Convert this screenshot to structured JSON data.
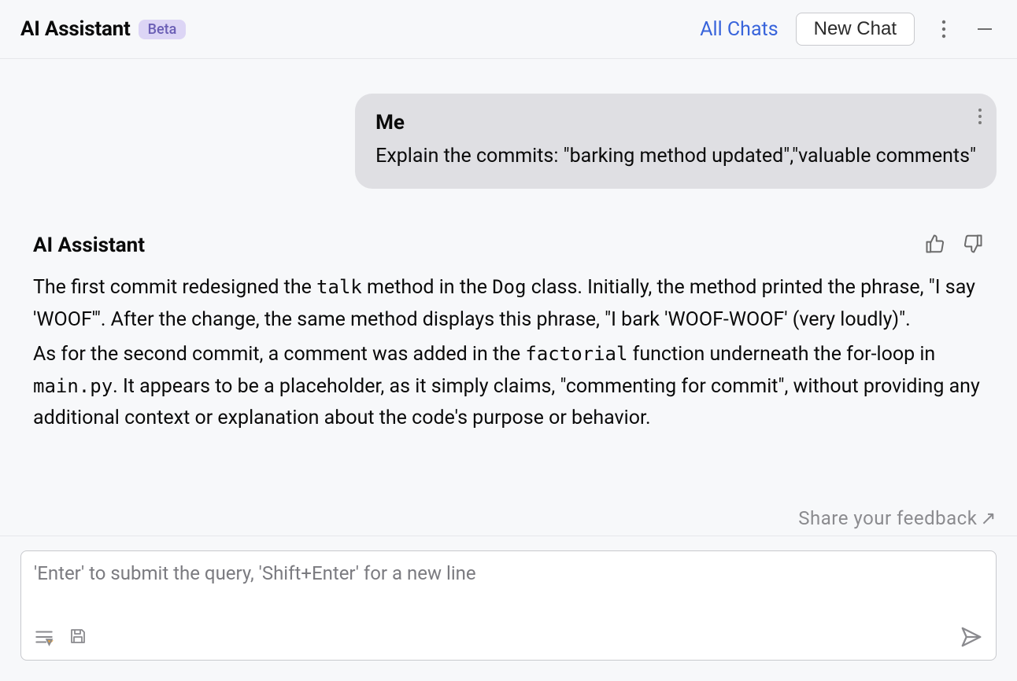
{
  "header": {
    "title": "AI Assistant",
    "badge": "Beta",
    "all_chats": "All Chats",
    "new_chat": "New Chat"
  },
  "messages": {
    "user": {
      "sender": "Me",
      "text": "Explain the commits: \"barking method updated\",\"valuable comments\""
    },
    "ai": {
      "sender": "AI Assistant",
      "p1_a": "The first commit redesigned the ",
      "p1_code1": "talk",
      "p1_b": " method in the ",
      "p1_code2": "Dog",
      "p1_c": " class. Initially, the method printed the phrase, \"I say 'WOOF'\". After the change, the same method displays this phrase, \"I bark 'WOOF-WOOF' (very loudly)\".",
      "p2_a": "As for the second commit, a comment was added in the ",
      "p2_code1": "factorial",
      "p2_b": " function underneath the for-loop in ",
      "p2_code2": "main.py",
      "p2_c": ". It appears to be a placeholder, as it simply claims, \"commenting for commit\", without providing any additional context or explanation about the code's purpose or behavior."
    }
  },
  "feedback": {
    "label": "Share your feedback",
    "arrow": "↗"
  },
  "input": {
    "placeholder": "'Enter' to submit the query, 'Shift+Enter' for a new line"
  }
}
